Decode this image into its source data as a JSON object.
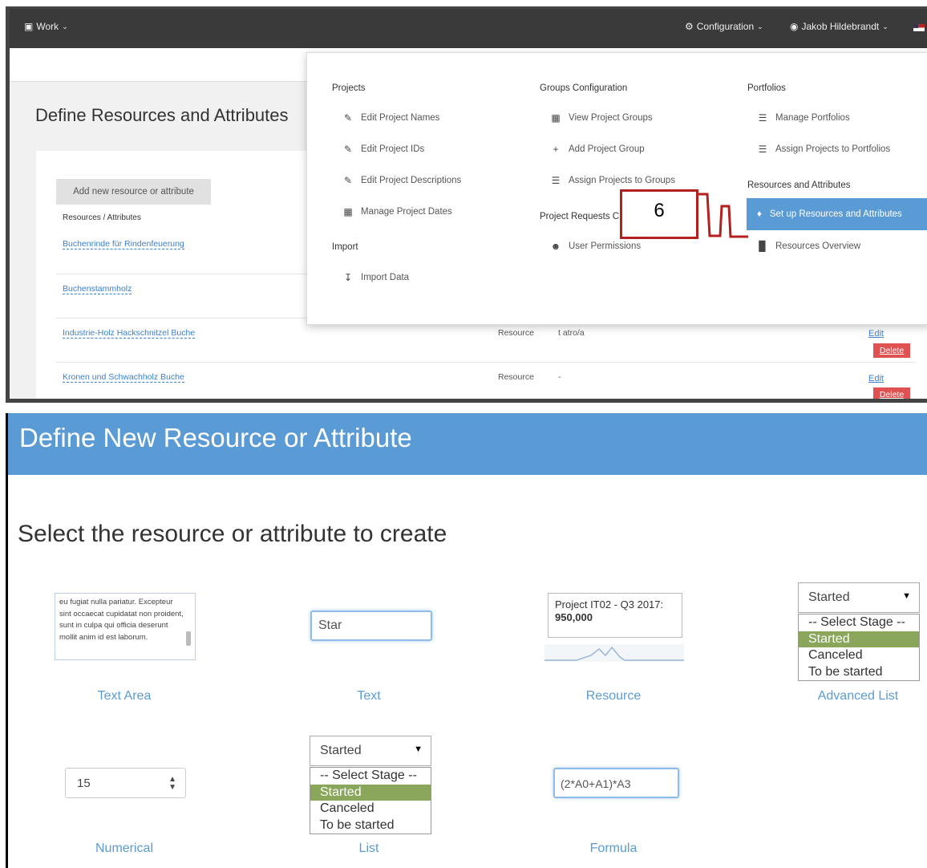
{
  "navbar": {
    "work": "Work",
    "configuration": "Configuration",
    "user": "Jakob Hildebrandt"
  },
  "page": {
    "title": "Define Resources and Attributes",
    "add_button": "Add new resource or attribute",
    "column_header": "Resources / Attributes",
    "resources": [
      {
        "name": "Buchenrinde für Rindenfeuerung",
        "type": "",
        "unit": ""
      },
      {
        "name": "Buchenstammholz",
        "type": "",
        "unit": ""
      },
      {
        "name": "Industrie-Holz Hackschnitzel Buche",
        "type": "Resource",
        "unit": "t atro/a"
      },
      {
        "name": "Kronen und Schwachholz Buche",
        "type": "Resource",
        "unit": "-"
      }
    ],
    "edit_label": "Edit",
    "delete_label": "Delete"
  },
  "mega_menu": {
    "projects": {
      "heading": "Projects",
      "items": [
        "Edit Project Names",
        "Edit Project IDs",
        "Edit Project Descriptions",
        "Manage Project Dates"
      ]
    },
    "import": {
      "heading": "Import",
      "items": [
        "Import Data"
      ]
    },
    "groups": {
      "heading": "Groups Configuration",
      "items": [
        "View Project Groups",
        "Add Project Group",
        "Assign Projects to Groups"
      ]
    },
    "requests": {
      "heading": "Project Requests C",
      "items": [
        "User Permissions"
      ]
    },
    "portfolios": {
      "heading": "Portfolios",
      "items": [
        "Manage Portfolios",
        "Assign Projects to Portfolios"
      ]
    },
    "resources": {
      "heading": "Resources and Attributes",
      "active_item": "Set up Resources and Attributes",
      "items": [
        "Resources Overview"
      ]
    },
    "callout_number": "6",
    "highlight_color": "#5b9bd5",
    "callout_color": "#b41f1f"
  },
  "define_new": {
    "header": "Define New Resource or Attribute",
    "subtitle": "Select the resource or attribute to create",
    "text_area": {
      "content": "eu fugiat nulla pariatur. Excepteur sint occaecat cupidatat non proident, sunt in culpa qui officia deserunt mollit anim id est laborum.",
      "label": "Text Area"
    },
    "text": {
      "value": "Star",
      "label": "Text"
    },
    "resource": {
      "tooltip_title": "Project IT02 - Q3 2017:",
      "tooltip_value": "950,000",
      "label": "Resource"
    },
    "advanced_list": {
      "selected": "Started",
      "options": [
        "-- Select Stage --",
        "Started",
        "Canceled",
        "To be started"
      ],
      "highlighted": "Started",
      "label": "Advanced List"
    },
    "numerical": {
      "value": "15",
      "label": "Numerical"
    },
    "list": {
      "selected": "Started",
      "options": [
        "-- Select Stage --",
        "Started",
        "Canceled",
        "To be started"
      ],
      "highlighted": "Started",
      "label": "List"
    },
    "formula": {
      "value": "(2*A0+A1)*A3",
      "label": "Formula"
    },
    "header_color": "#5b9bd5",
    "option_highlight_color": "#8aa65a"
  }
}
